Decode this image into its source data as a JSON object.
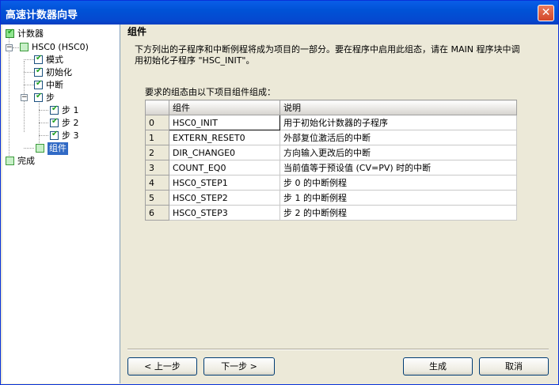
{
  "window": {
    "title": "高速计数器向导",
    "close_label": "✕"
  },
  "tree": {
    "root": "计数器",
    "hsc": "HSC0 (HSC0)",
    "mode": "模式",
    "init": "初始化",
    "interrupt": "中断",
    "step": "步",
    "step1": "步 1",
    "step2": "步 2",
    "step3": "步 3",
    "components": "组件",
    "finish": "完成",
    "expand_glyph": "−"
  },
  "content": {
    "title": "组件",
    "description": "下方列出的子程序和中断例程将成为项目的一部分。要在程序中启用此组态，请在 MAIN 程序块中调用初始化子程序 \"HSC_INIT\"。",
    "required_label": "要求的组态由以下项目组件组成：",
    "columns": {
      "index": "",
      "component": "组件",
      "description": "说明"
    },
    "rows": [
      {
        "index": "0",
        "component": "HSC0_INIT",
        "description": "用于初始化计数器的子程序"
      },
      {
        "index": "1",
        "component": "EXTERN_RESET0",
        "description": "外部复位激活后的中断"
      },
      {
        "index": "2",
        "component": "DIR_CHANGE0",
        "description": "方向输入更改后的中断"
      },
      {
        "index": "3",
        "component": "COUNT_EQ0",
        "description": "当前值等于预设值 (CV=PV) 时的中断"
      },
      {
        "index": "4",
        "component": "HSC0_STEP1",
        "description": "步 0 的中断例程"
      },
      {
        "index": "5",
        "component": "HSC0_STEP2",
        "description": "步 1 的中断例程"
      },
      {
        "index": "6",
        "component": "HSC0_STEP3",
        "description": "步 2 的中断例程"
      }
    ]
  },
  "buttons": {
    "prev": "< 上一步",
    "next": "下一步 >",
    "generate": "生成",
    "cancel": "取消"
  }
}
